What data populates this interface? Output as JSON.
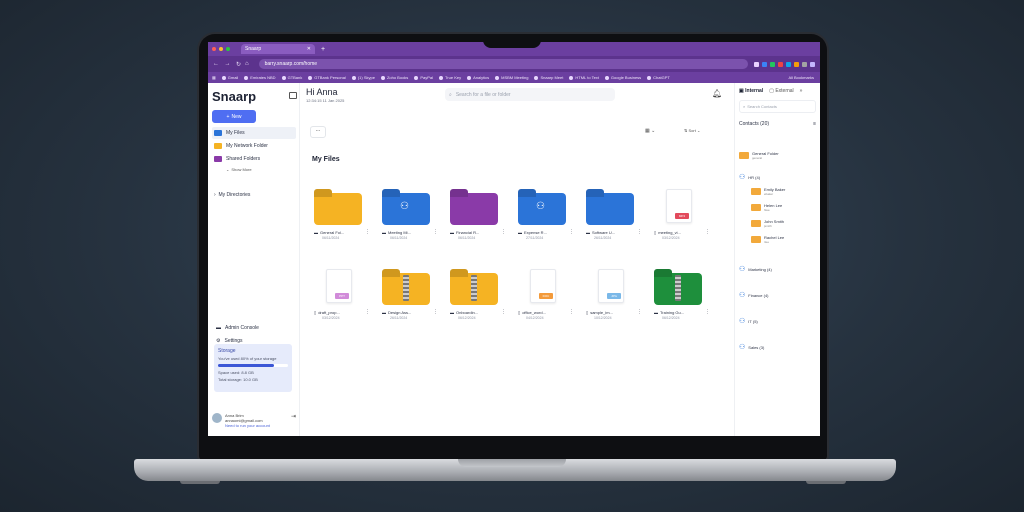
{
  "browser": {
    "tab_title": "Snaarp",
    "url": "barry.snaarp.com/home",
    "bookmarks": [
      "Gmail",
      "Emirates NBD",
      "GTBank",
      "GTBank Personal",
      "(1) Skype",
      "Zoho Books",
      "PayPal",
      "True Key",
      "Analytics",
      "MSBM Meeting",
      "Snaarp Meet",
      "HTML to Text",
      "Google Business",
      "ChatGPT"
    ],
    "all_bookmarks": "All Bookmarks"
  },
  "sidebar": {
    "logo": "Snaarp",
    "new_label": "New",
    "items": [
      {
        "label": "My Files"
      },
      {
        "label": "My Network Folder"
      },
      {
        "label": "Shared Folders"
      }
    ],
    "show_more": "Show More",
    "my_directories": "My Directories",
    "admin_console": "Admin Console",
    "settings": "Settings",
    "storage": {
      "title": "Storage",
      "used_text": "You've used 80% of your storage",
      "used_fraction": 0.8,
      "space_used": "Space used: 8.8 GB",
      "total": "Total storage: 10.0 GB"
    },
    "user": {
      "name": "Anna Brim",
      "email": "annaomi@gmail.com",
      "link": "Need to run your account"
    }
  },
  "header": {
    "greeting": "Hi Anna",
    "date": "12:34:15 11 Jan 2025",
    "search_placeholder": "Search for a file or folder",
    "more": "...",
    "sort": "Sort"
  },
  "main": {
    "section_title": "My Files"
  },
  "files": [
    {
      "name": "General Fol...",
      "date": "06/11/2024",
      "kind": "folder",
      "color": "#f5b323"
    },
    {
      "name": "Meeting Mi...",
      "date": "06/11/2024",
      "kind": "folder-people",
      "color": "#2b74d8"
    },
    {
      "name": "Financial R...",
      "date": "06/11/2024",
      "kind": "folder",
      "color": "#8a3aa8"
    },
    {
      "name": "Expense R...",
      "date": "27/11/2024",
      "kind": "folder-people",
      "color": "#2b74d8"
    },
    {
      "name": "Software U...",
      "date": "26/11/2024",
      "kind": "folder",
      "color": "#2b74d8"
    },
    {
      "name": "meeting_vi...",
      "date": "03/12/2024",
      "kind": "doc",
      "badge": "MP4",
      "badge_color": "#e24a5c"
    },
    {
      "name": "draft_prop...",
      "date": "03/12/2024",
      "kind": "doc",
      "badge": "PPT",
      "badge_color": "#d18bd9"
    },
    {
      "name": "Design Ass...",
      "date": "26/11/2024",
      "kind": "zip",
      "color": "#f5b323"
    },
    {
      "name": "Onboardin...",
      "date": "06/12/2024",
      "kind": "zip",
      "color": "#f5b323"
    },
    {
      "name": "office_word...",
      "date": "04/12/2024",
      "kind": "doc",
      "badge": "DOC",
      "badge_color": "#f39a3a"
    },
    {
      "name": "sample_im...",
      "date": "10/12/2024",
      "kind": "doc",
      "badge": "JPG",
      "badge_color": "#7ab8e8"
    },
    {
      "name": "Training Gu...",
      "date": "06/12/2024",
      "kind": "zip",
      "color": "#1e8f3c"
    }
  ],
  "right_panel": {
    "tab_internal": "Internal",
    "tab_external": "External",
    "search_placeholder": "Search Contacts",
    "contacts_label": "Contacts (20)",
    "general_folder": {
      "name": "General Folder",
      "sub": "general"
    },
    "hr": "HR (4)",
    "people": [
      {
        "name": "Emily Baker",
        "sub": "ebaker"
      },
      {
        "name": "Helen Lee",
        "sub": "hlee"
      },
      {
        "name": "John Smith",
        "sub": "jsmith"
      },
      {
        "name": "Rachel Lee",
        "sub": "rlee"
      }
    ],
    "groups": [
      "Marketing (4)",
      "Finance (4)",
      "IT (5)",
      "Sales (3)"
    ]
  }
}
